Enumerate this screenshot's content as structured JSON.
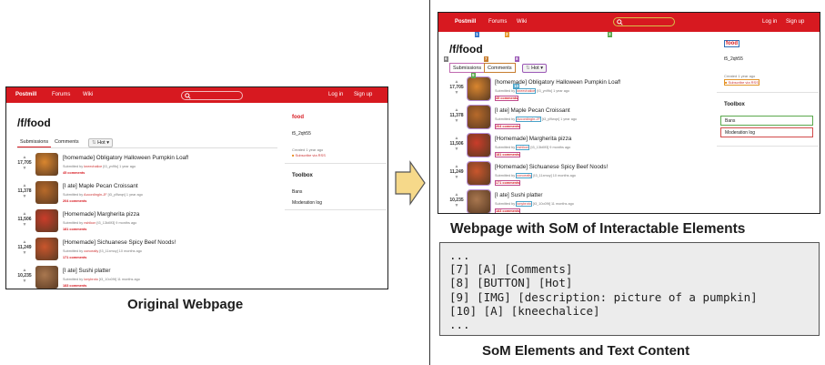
{
  "site": {
    "brand": "Postmill",
    "nav_forums": "Forums",
    "nav_wiki": "Wiki",
    "login": "Log in",
    "signup": "Sign up"
  },
  "forum": {
    "title": "/f/food",
    "tab_submissions": "Submissions",
    "tab_comments": "Comments",
    "hot_label": "Hot"
  },
  "posts": [
    {
      "score": "17,705",
      "title": "[homemade] Obligatory Halloween Pumpkin Loaf!",
      "submitted": "Submitted by",
      "user": "kneechalice",
      "meta": "[t3_yn9fo] 1 year ago",
      "comments": "45 comments"
    },
    {
      "score": "11,378",
      "title": "[I ate] Maple Pecan Croissant",
      "submitted": "Submitted by",
      "user": "AccordingIn-JF",
      "meta": "[t3_yl9wqn] 1 year ago",
      "comments": "204 comments"
    },
    {
      "score": "11,506",
      "title": "[Homemade] Margherita pizza",
      "submitted": "Submitted by",
      "user": "nshikon",
      "meta": "[t3_13kt0f3] 9 months ago",
      "comments": "181 comments"
    },
    {
      "score": "11,249",
      "title": "[Homemade] Sichuanese Spicy Beef Noods!",
      "submitted": "Submitted by",
      "user": "concealty",
      "meta": "[t3_11xmoy] 10 months ago",
      "comments": "171 comments"
    },
    {
      "score": "10,235",
      "title": "[I ate] Sushi platter",
      "submitted": "Submitted by",
      "user": "lonybroto",
      "meta": "[t3_10o09t] 11 months ago",
      "comments": "183 comments"
    }
  ],
  "sidebar": {
    "forum_name": "food",
    "subtitle": "t5_2qh55",
    "created": "Created 1 year ago",
    "rss": "Subscribe via RSS",
    "toolbox": "Toolbox",
    "bans": "Bans",
    "modlog": "Moderation log"
  },
  "captions": {
    "original": "Original Webpage",
    "som": "Webpage with SoM of Interactable Elements",
    "text": "SoM Elements and Text Content"
  },
  "som_labels": [
    "1",
    "2",
    "3",
    "4",
    "5",
    "6",
    "7",
    "8",
    "9",
    "10"
  ],
  "som_text_lines": [
    "...",
    "[7] [A] [Comments]",
    "[8] [BUTTON] [Hot]",
    "[9] [IMG] [description: picture of a pumpkin]",
    "[10] [A] [kneechalice]",
    "..."
  ],
  "colors": {
    "nav": "#d71920",
    "arrow": "#f6d98a"
  }
}
